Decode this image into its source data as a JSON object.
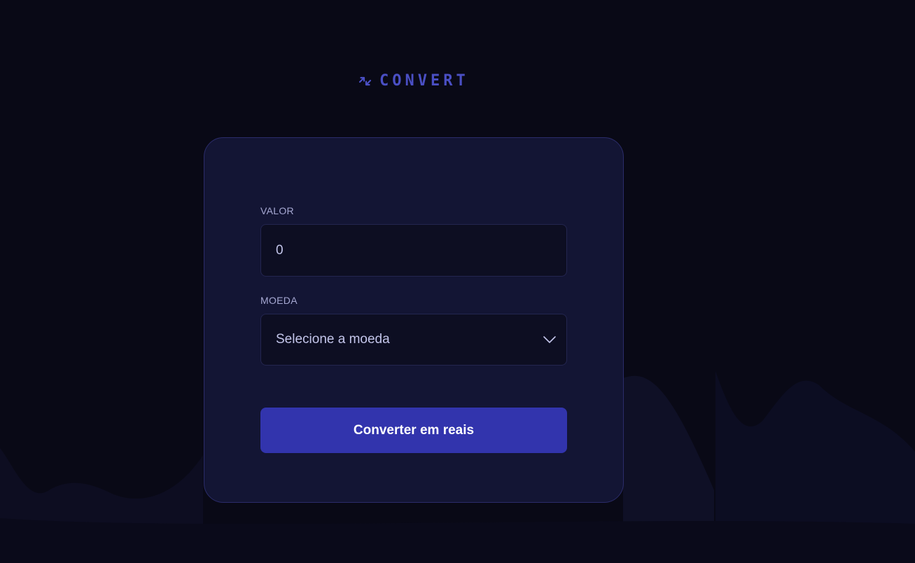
{
  "logo": {
    "icon": "arrows-exchange-icon",
    "text": "CONVERT"
  },
  "form": {
    "value_label": "VALOR",
    "value_input": "0",
    "currency_label": "MOEDA",
    "currency_select": "Selecione a moeda",
    "submit_label": "Converter em reais"
  },
  "colors": {
    "background": "#090916",
    "card": "#131534",
    "accent": "#3234ad",
    "logo": "#4a4fc4"
  }
}
